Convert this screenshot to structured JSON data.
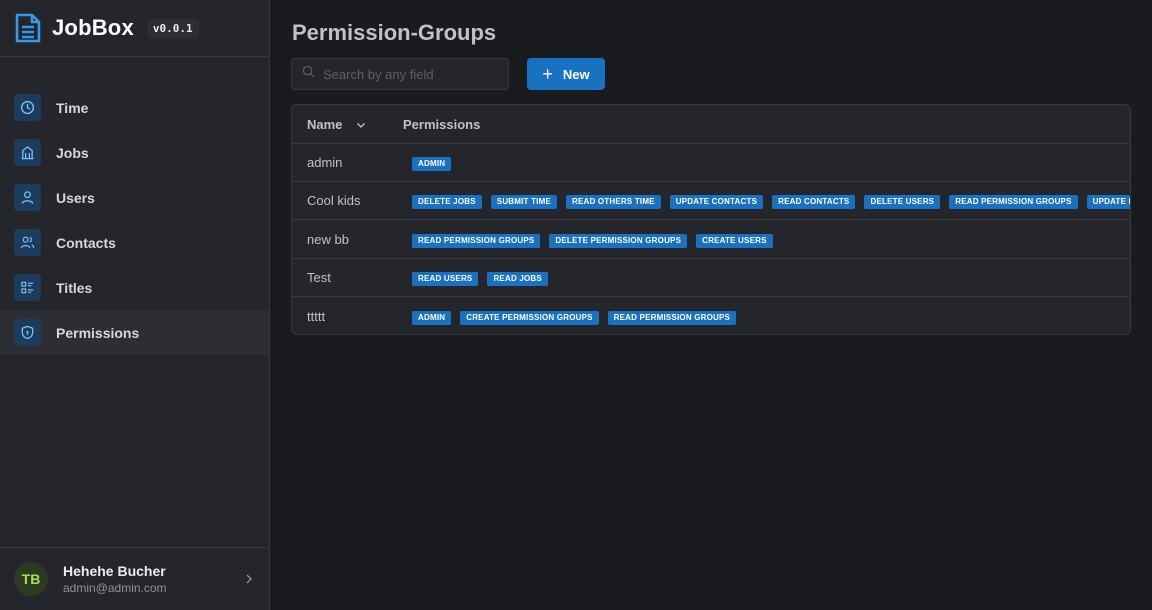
{
  "app": {
    "name": "JobBox",
    "version": "v0.0.1"
  },
  "nav": [
    {
      "label": "Time",
      "icon": "clock-icon"
    },
    {
      "label": "Jobs",
      "icon": "building-icon"
    },
    {
      "label": "Users",
      "icon": "user-icon"
    },
    {
      "label": "Contacts",
      "icon": "users-icon"
    },
    {
      "label": "Titles",
      "icon": "list-details-icon"
    },
    {
      "label": "Permissions",
      "icon": "shield-icon",
      "active": true
    }
  ],
  "user": {
    "initials": "TB",
    "name": "Hehehe Bucher",
    "email": "admin@admin.com"
  },
  "page": {
    "title": "Permission-Groups",
    "search_placeholder": "Search by any field",
    "new_label": "New"
  },
  "table": {
    "columns": [
      "Name",
      "Permissions"
    ],
    "rows": [
      {
        "name": "admin",
        "permissions": [
          "ADMIN"
        ]
      },
      {
        "name": "Cool kids",
        "permissions": [
          "DELETE JOBS",
          "SUBMIT TIME",
          "READ OTHERS TIME",
          "UPDATE CONTACTS",
          "READ CONTACTS",
          "DELETE USERS",
          "READ PERMISSION GROUPS",
          "UPDATE PERMI"
        ]
      },
      {
        "name": "new bb",
        "permissions": [
          "READ PERMISSION GROUPS",
          "DELETE PERMISSION GROUPS",
          "CREATE USERS"
        ]
      },
      {
        "name": "Test",
        "permissions": [
          "READ USERS",
          "READ JOBS"
        ]
      },
      {
        "name": "ttttt",
        "permissions": [
          "ADMIN",
          "CREATE PERMISSION GROUPS",
          "READ PERMISSION GROUPS"
        ]
      }
    ]
  },
  "colors": {
    "accent": "#1971c2",
    "background": "#1a1b1e",
    "sidebar": "#25262b",
    "avatar_text": "#a9e34b"
  }
}
